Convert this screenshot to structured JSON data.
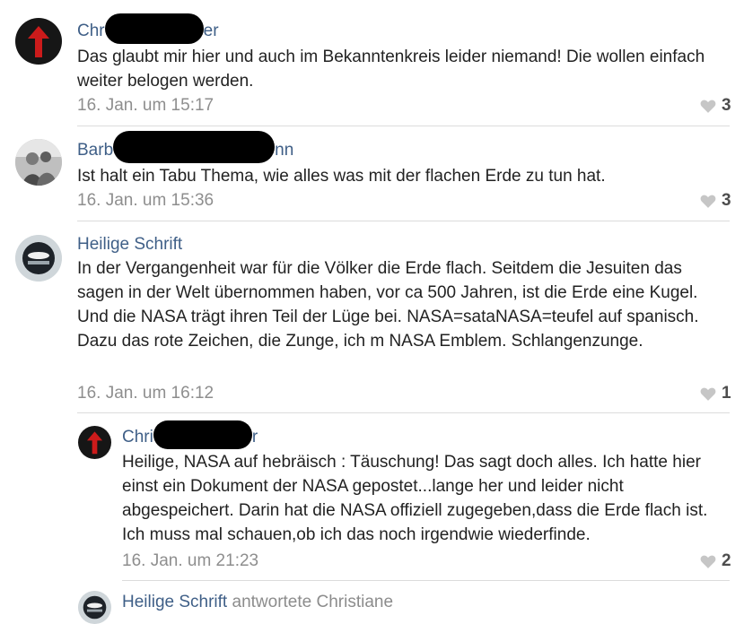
{
  "comments": [
    {
      "author_start": "Chr",
      "author_end": "er",
      "text": "Das glaubt mir hier und auch im Bekanntenkreis leider niemand! Die wollen einfach weiter belogen werden.",
      "date": "16. Jan. um 15:17",
      "likes": "3",
      "avatar_icon": "red-arrow-up-icon"
    },
    {
      "author_start": "Barb",
      "author_end": "nn",
      "text": "Ist halt ein Tabu Thema, wie alles was mit der flachen Erde zu tun hat.",
      "date": "16. Jan. um 15:36",
      "likes": "3",
      "avatar_icon": "profile-photo"
    },
    {
      "author": "Heilige Schrift",
      "text": "In der Vergangenheit war für die Völker die Erde flach. Seitdem die Jesuiten das sagen in der Welt übernommen haben, vor ca 500 Jahren, ist die Erde eine Kugel. Und die NASA trägt ihren Teil der Lüge bei. NASA=sataNASA=teufel auf spanisch. Dazu das rote Zeichen, die Zunge, ich m NASA Emblem. Schlangenzunge.",
      "date": "16. Jan. um 16:12",
      "likes": "1",
      "avatar_icon": "emblem-icon"
    }
  ],
  "replies": [
    {
      "author_start": "Chri",
      "author_end": "r",
      "text": "Heilige, NASA auf hebräisch : Täuschung! Das sagt doch alles. Ich hatte hier einst ein Dokument der NASA gepostet...lange her und leider nicht abgespeichert. Darin hat die NASA offiziell zugegeben,dass die Erde flach ist. Ich muss mal schauen,ob ich das noch irgendwie wiederfinde.",
      "date": "16. Jan. um 21:23",
      "likes": "2",
      "avatar_icon": "red-arrow-up-icon"
    },
    {
      "author": "Heilige Schrift",
      "suffix": "antwortete Christiane",
      "avatar_icon": "emblem-icon"
    }
  ],
  "colors": {
    "author": "#3f5f87",
    "meta": "#8e8e8e",
    "arrow": "#cc1b1b",
    "heart": "#c6c6c6"
  }
}
